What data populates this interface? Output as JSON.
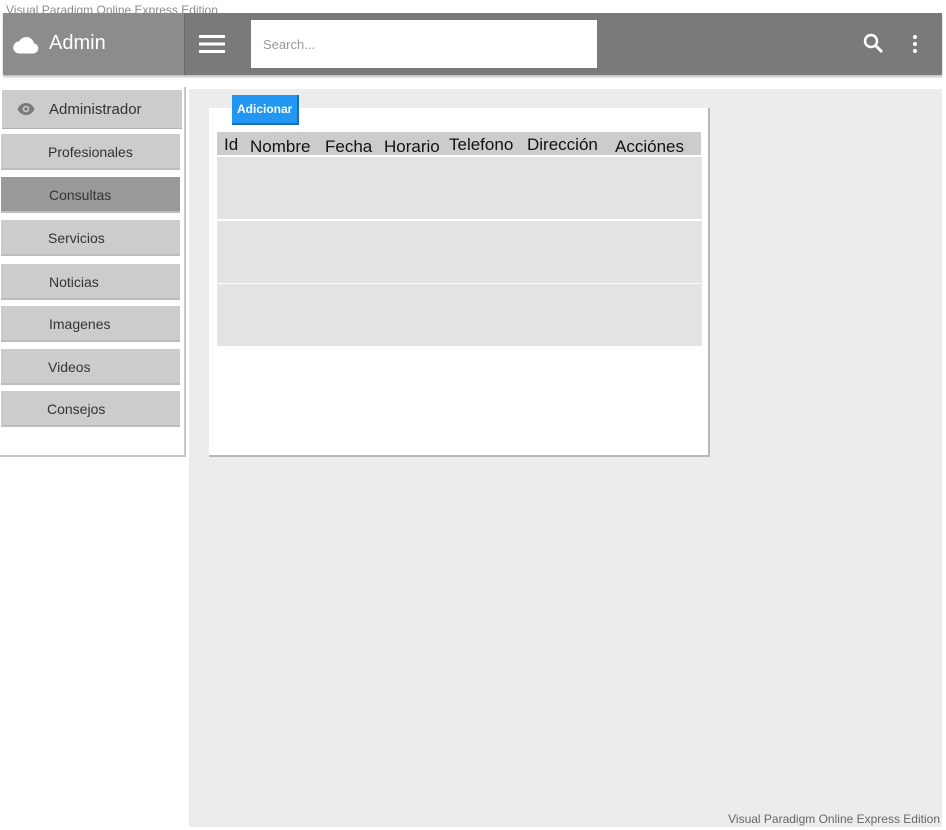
{
  "watermark": {
    "top": "Visual Paradigm Online Express Edition",
    "bottom": "Visual Paradigm Online Express Edition"
  },
  "topbar": {
    "title": "Admin",
    "search_placeholder": "Search...",
    "icons": [
      "cloud-icon",
      "menu-icon",
      "search-icon",
      "more-vert-icon"
    ]
  },
  "sidebar": {
    "header": "Administrador",
    "items": [
      {
        "label": "Profesionales",
        "active": false
      },
      {
        "label": "Consultas",
        "active": true
      },
      {
        "label": "Servicios",
        "active": false
      },
      {
        "label": "Noticias",
        "active": false
      },
      {
        "label": "Imagenes",
        "active": false
      },
      {
        "label": "Videos",
        "active": false
      },
      {
        "label": "Consejos",
        "active": false
      }
    ]
  },
  "main": {
    "add_button": "Adicionar",
    "table": {
      "columns": [
        "Id",
        "Nombre",
        "Fecha",
        "Horario",
        "Telefono",
        "Dirección",
        "Acciónes"
      ],
      "rows": [
        [],
        [],
        []
      ]
    }
  },
  "colors": {
    "topbar": "#7a7a7a",
    "brand": "#8c8c8c",
    "accent": "#2196f3",
    "sidebar_item": "#cccccc",
    "sidebar_active": "#999999",
    "main_bg": "#ececec",
    "row_bg": "#e3e3e3"
  }
}
